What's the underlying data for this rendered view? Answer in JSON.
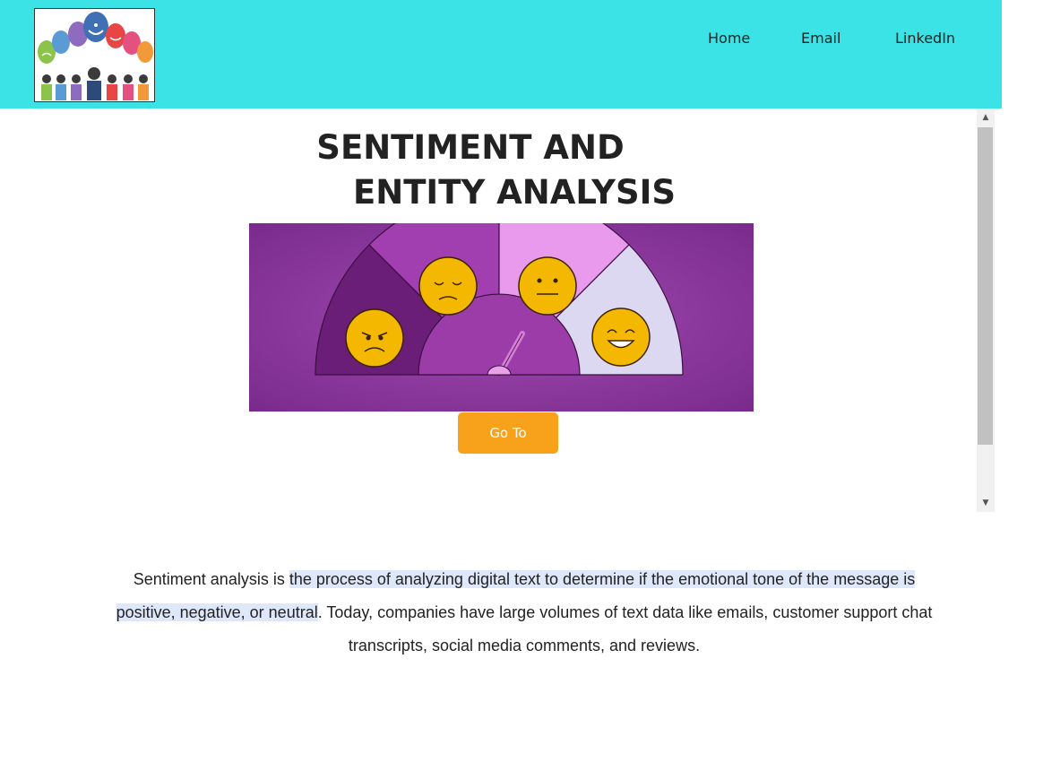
{
  "nav": {
    "home": "Home",
    "email": "Email",
    "linkedin": "LinkedIn"
  },
  "hero": {
    "title_line1": "SENTIMENT AND",
    "title_line2": "ENTITY ANALYSIS",
    "button_label": "Go To"
  },
  "description": {
    "part1": "Sentiment analysis is ",
    "highlight_a": "the process of analyzing digital text to determine if the emotional tone of the message is",
    "highlight_b": "positive, negative, or neutral",
    "part2": ". Today, companies have large volumes of text data like emails, customer support chat transcripts, social media comments, and reviews."
  },
  "colors": {
    "header_bg": "#3ce3e6",
    "button_bg": "#f7a21a",
    "banner_bg": "#8e3aa0",
    "highlight": "#dfe8fb"
  },
  "icons": [
    "sentiment-logo",
    "sentiment-meter-illustration",
    "scroll-up-icon",
    "scroll-down-icon"
  ]
}
